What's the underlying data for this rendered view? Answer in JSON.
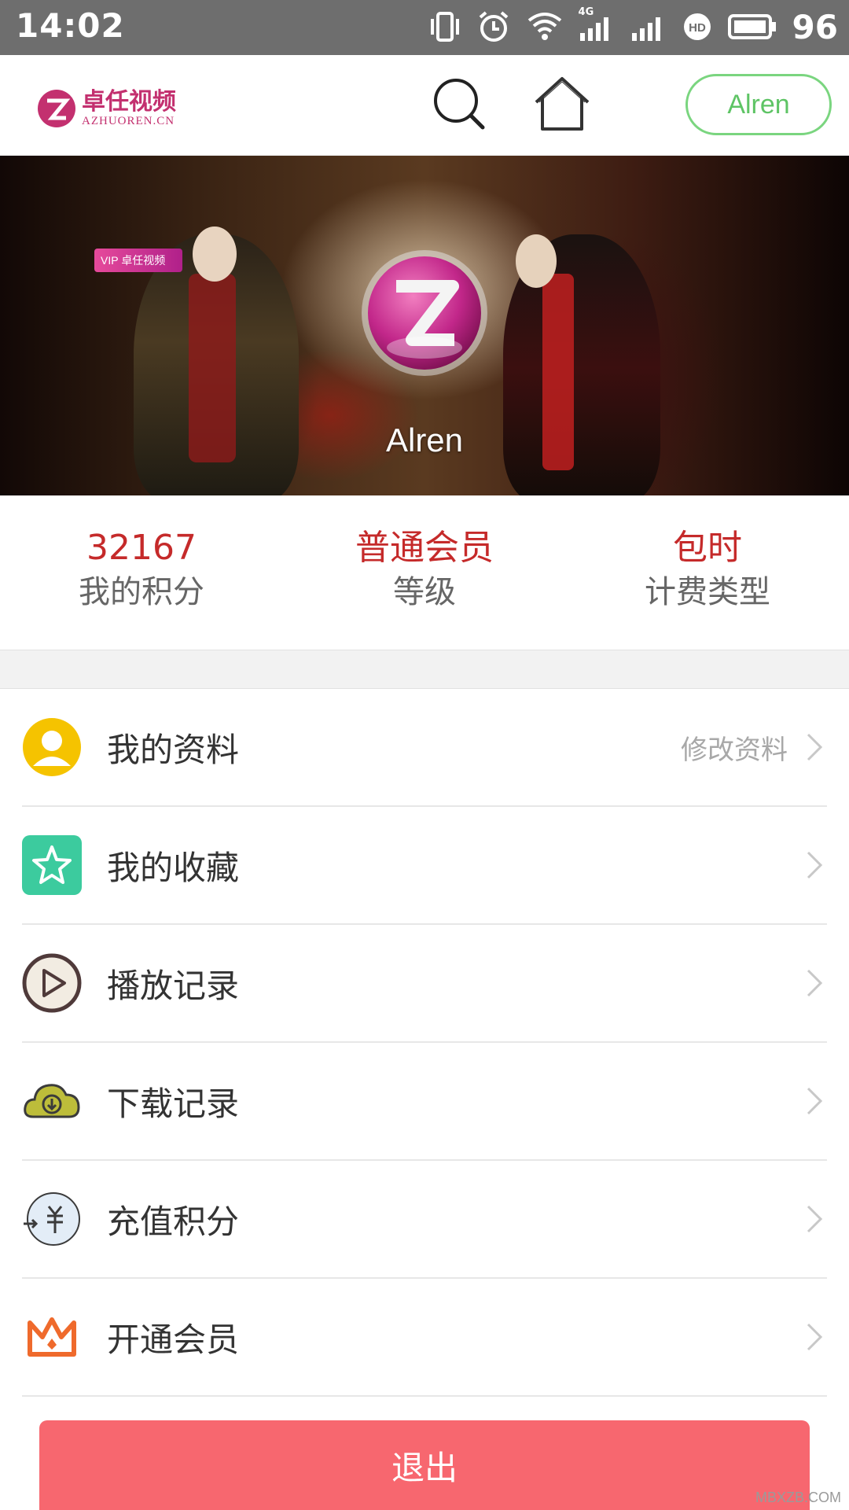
{
  "status_bar": {
    "time": "14:02",
    "network_type": "4G",
    "battery": "96",
    "icons": [
      "vibrate-icon",
      "alarm-icon",
      "wifi-icon",
      "signal-icon",
      "hd-icon",
      "battery-icon"
    ]
  },
  "header": {
    "logo_cn": "卓任视频",
    "logo_en": "AZHUOREN.CN",
    "user_button": "Alren"
  },
  "banner": {
    "vip_tag": "VIP 卓任视频",
    "username": "Alren"
  },
  "stats": [
    {
      "value": "32167",
      "label": "我的积分"
    },
    {
      "value": "普通会员",
      "label": "等级"
    },
    {
      "value": "包时",
      "label": "计费类型"
    }
  ],
  "menu": [
    {
      "label": "我的资料",
      "extra": "修改资料",
      "icon": "profile-icon"
    },
    {
      "label": "我的收藏",
      "icon": "favorites-icon"
    },
    {
      "label": "播放记录",
      "icon": "play-history-icon"
    },
    {
      "label": "下载记录",
      "icon": "download-icon"
    },
    {
      "label": "充值积分",
      "icon": "recharge-icon"
    },
    {
      "label": "开通会员",
      "icon": "crown-icon"
    }
  ],
  "logout_label": "退出",
  "watermark": "MBXZB.COM",
  "colors": {
    "accent_red": "#c52a2a",
    "logout_bg": "#f7676f",
    "user_button_green": "#7ad57f",
    "status_bar": "#6e6e6e"
  }
}
